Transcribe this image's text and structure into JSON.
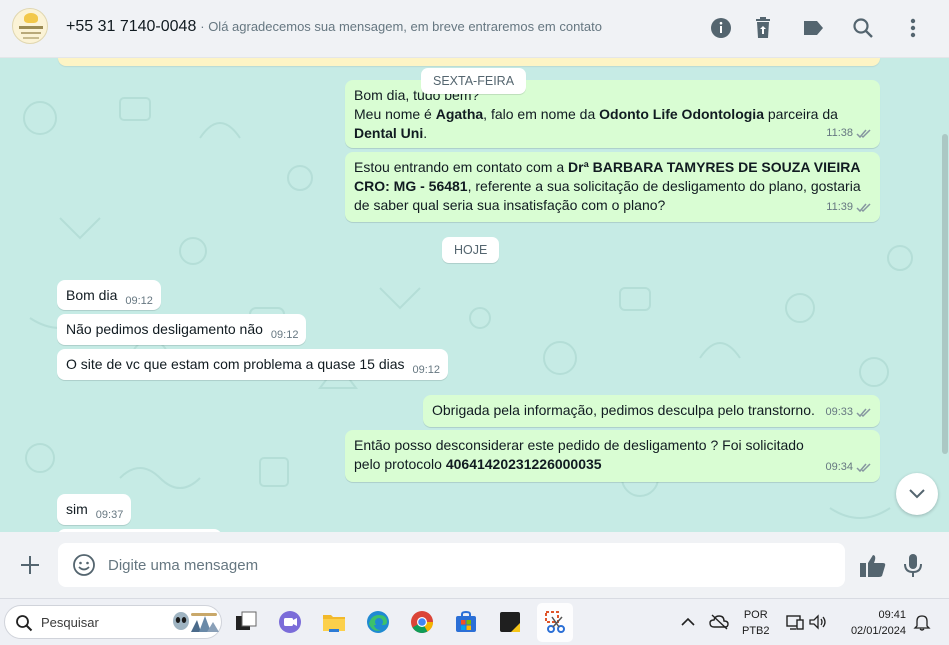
{
  "header": {
    "phone": "+55 31 7140-0048",
    "status": "Olá agradecemos sua mensagem, em breve entraremos em contato",
    "icons": [
      "info-icon",
      "trash-icon",
      "label-icon",
      "search-icon",
      "menu-icon"
    ]
  },
  "chat": {
    "day_friday": "SEXTA-FEIRA",
    "day_today": "HOJE",
    "msg1": {
      "line1": "Bom dia, tudo bem?",
      "line2_prefix": "Meu nome é ",
      "name": "Agatha",
      "line2_mid": ", falo em nome da ",
      "company": "Odonto Life Odontologia",
      "line2_suffix": " parceira da",
      "partner": "Dental Uni",
      "end": ".",
      "time": "11:38"
    },
    "msg2": {
      "prefix": "Estou entrando em contato com a ",
      "doctor": "Drª BARBARA TAMYRES DE SOUZA VIEIRA CRO: MG - 56481",
      "suffix": ", referente a sua solicitação de desligamento do plano, gostaria de saber qual seria sua insatisfação com o plano?",
      "time": "11:39"
    },
    "in1": {
      "text": "Bom dia",
      "time": "09:12"
    },
    "in2": {
      "text": "Não pedimos desligamento não",
      "time": "09:12"
    },
    "in3": {
      "text": "O site de vc que estam com problema a quase 15 dias",
      "time": "09:12"
    },
    "msg3": {
      "text": "Obrigada pela informação, pedimos desculpa pelo transtorno.",
      "time": "09:33"
    },
    "msg4": {
      "prefix": "Então posso desconsiderar este pedido de desligamento ? Foi solicitado pelo protocolo ",
      "protocol": "40641420231226000035",
      "time": "09:34"
    },
    "in4": {
      "text": "sim",
      "time": "09:37"
    }
  },
  "composer": {
    "placeholder": "Digite uma mensagem"
  },
  "taskbar": {
    "search_label": "Pesquisar",
    "lang_top": "POR",
    "lang_bottom": "PTB2",
    "time": "09:41",
    "date": "02/01/2024"
  },
  "colors": {
    "chat_bg": "#c6ebe5",
    "outgoing": "#d9fdd3",
    "incoming": "#ffffff",
    "read_ticks": "#8696a0"
  }
}
